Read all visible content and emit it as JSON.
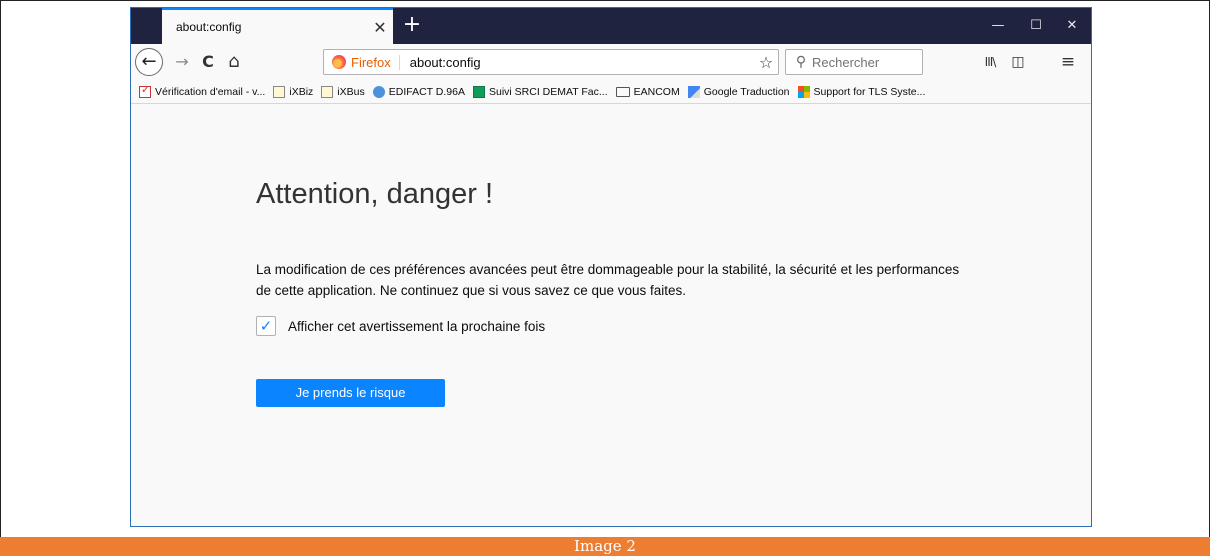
{
  "colors": {
    "accent": "#0a84ff",
    "titlebar": "#202340",
    "caption_bg": "#ed7d31",
    "firefox_label": "#e66000"
  },
  "tab": {
    "title": "about:config",
    "close": "✕"
  },
  "titlebar": {
    "new_tab": "+",
    "minimize": "—",
    "maximize": "☐",
    "close": "✕"
  },
  "nav": {
    "back": "←",
    "forward": "→",
    "reload": "C",
    "home": "⌂",
    "firefox_label": "Firefox",
    "url": "about:config",
    "star": "☆",
    "search_placeholder": "Rechercher",
    "search_glyph": "⚲",
    "library": "III\\",
    "sidebar": "◫",
    "menu": "≡"
  },
  "bookmarks": [
    {
      "label": "Vérification d'email - v...",
      "icon": "email-check-icon"
    },
    {
      "label": "iXBiz",
      "icon": "ixbiz-icon"
    },
    {
      "label": "iXBus",
      "icon": "ixbus-icon"
    },
    {
      "label": "EDIFACT D.96A",
      "icon": "un-globe-icon"
    },
    {
      "label": "Suivi SRCI DEMAT Fac...",
      "icon": "sheets-icon"
    },
    {
      "label": "EANCOM",
      "icon": "folder-icon"
    },
    {
      "label": "Google Traduction",
      "icon": "google-translate-icon"
    },
    {
      "label": "Support for TLS Syste...",
      "icon": "microsoft-icon"
    }
  ],
  "page": {
    "title": "Attention, danger !",
    "text_line1": "La modification de ces préférences avancées peut être dommageable pour la stabilité, la sécurité et les performances",
    "text_line2": "de cette application. Ne continuez que si vous savez ce que vous faites.",
    "checkbox_label": "Afficher cet avertissement la prochaine fois",
    "checkbox_mark": "✓",
    "button_label": "Je prends le risque"
  },
  "caption": "Image 2"
}
